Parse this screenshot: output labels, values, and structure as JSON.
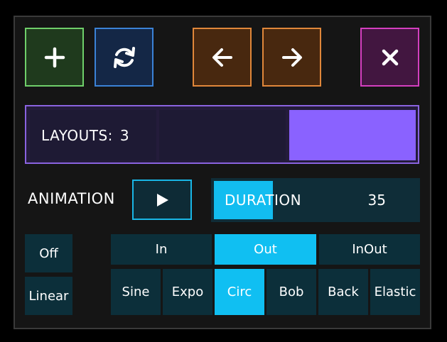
{
  "toolbar": {
    "add_icon": "plus-icon",
    "refresh_icon": "refresh-icon",
    "back_icon": "arrow-left-icon",
    "forward_icon": "arrow-right-icon",
    "close_icon": "close-icon"
  },
  "layouts": {
    "label": "LAYOUTS:",
    "count": "3",
    "selected_index": 2
  },
  "animation": {
    "label": "ANIMATION",
    "play_icon": "play-icon"
  },
  "duration": {
    "label": "DURATION",
    "value": "35",
    "fill_fraction": 0.29
  },
  "easing_modes": {
    "off": "Off",
    "linear": "Linear"
  },
  "easing_direction": {
    "options": [
      "In",
      "Out",
      "InOut"
    ],
    "selected": "Out"
  },
  "easing_curve": {
    "options": [
      "Sine",
      "Expo",
      "Circ",
      "Bob",
      "Back",
      "Elastic"
    ],
    "selected": "Circ"
  },
  "colors": {
    "accent_cyan": "#10bff2",
    "accent_purple": "#8a62ff",
    "button_dark": "#0c2f3a"
  }
}
